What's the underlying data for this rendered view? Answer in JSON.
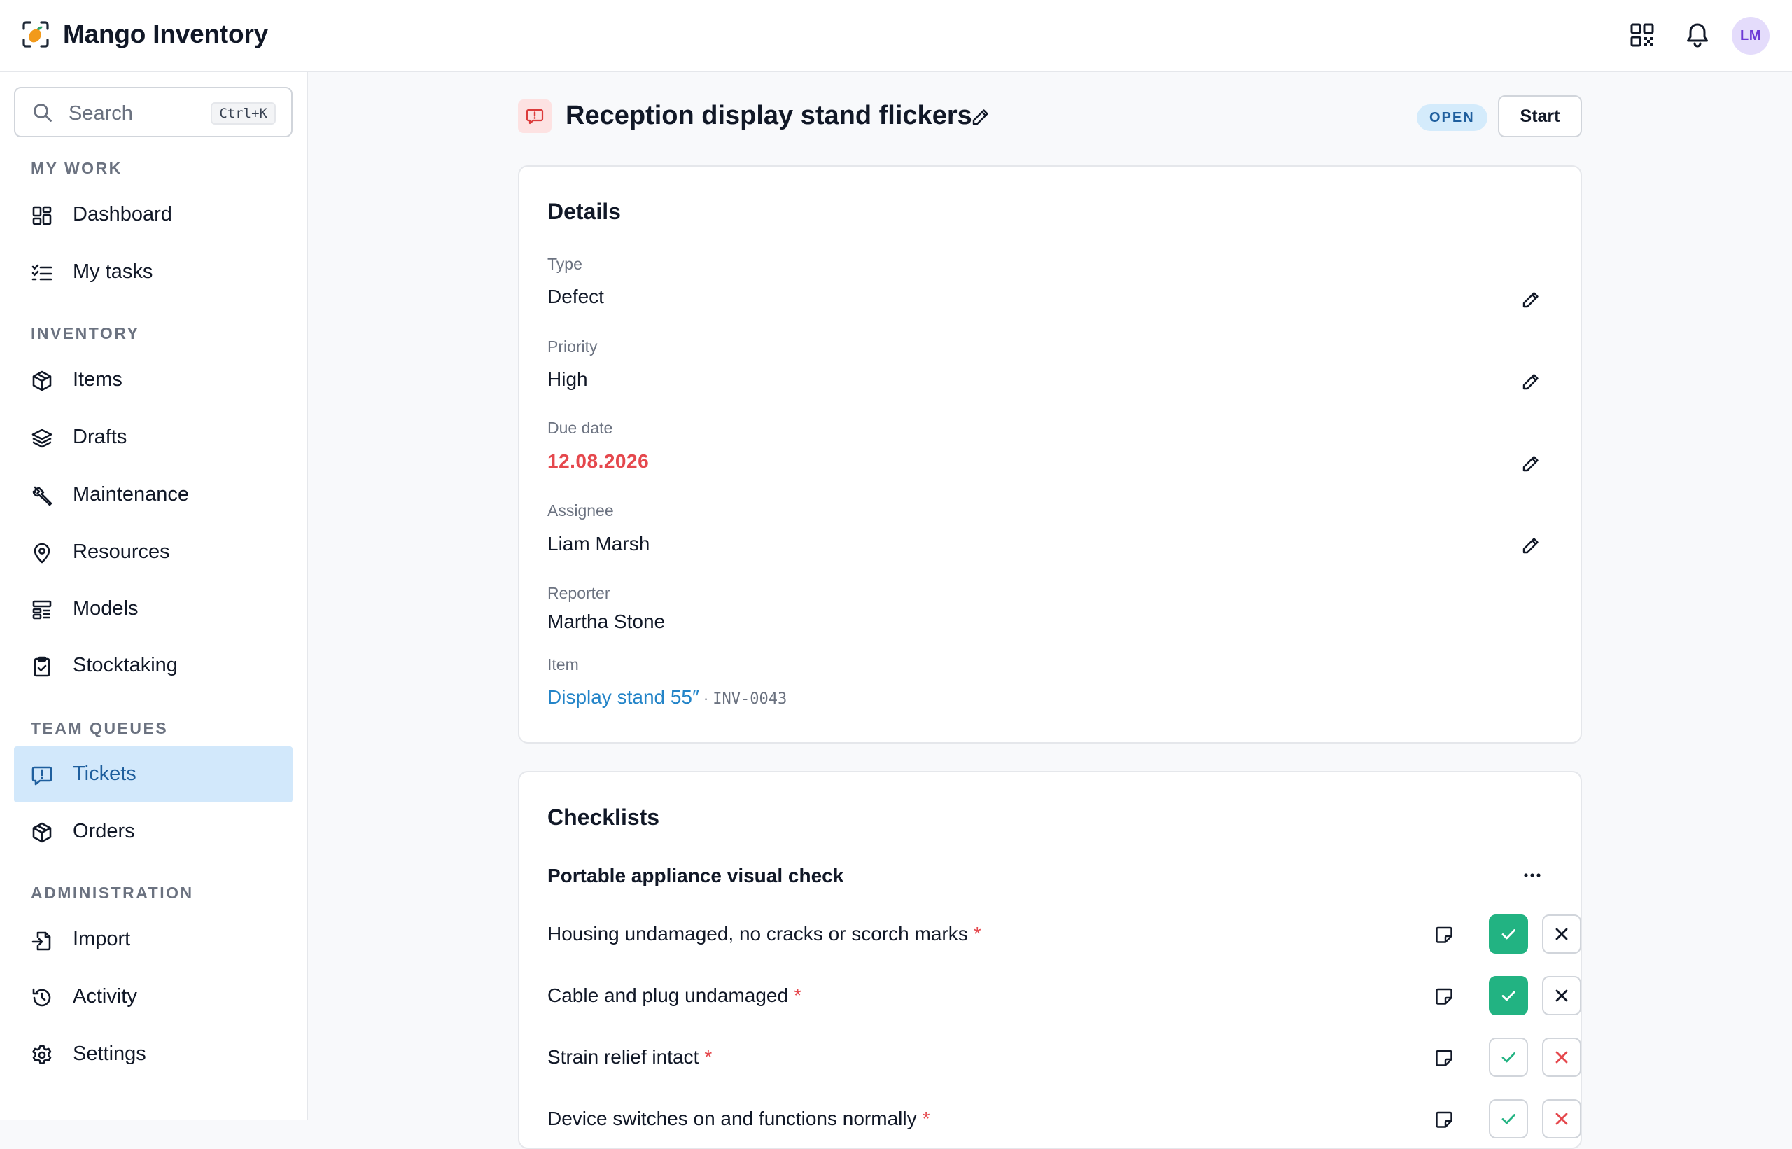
{
  "app": {
    "name": "Mango Inventory",
    "user_initials": "LM"
  },
  "header": {
    "icons": [
      "qr-code-icon",
      "bell-icon"
    ]
  },
  "sidebar": {
    "search_placeholder": "Search",
    "search_shortcut": "Ctrl+K",
    "sections": [
      {
        "label": "MY WORK",
        "items": [
          {
            "label": "Dashboard",
            "icon": "dashboard-icon"
          },
          {
            "label": "My tasks",
            "icon": "tasks-icon"
          }
        ]
      },
      {
        "label": "INVENTORY",
        "items": [
          {
            "label": "Items",
            "icon": "box-icon"
          },
          {
            "label": "Drafts",
            "icon": "layers-icon"
          },
          {
            "label": "Maintenance",
            "icon": "wrench-icon"
          },
          {
            "label": "Resources",
            "icon": "location-pin-icon"
          },
          {
            "label": "Models",
            "icon": "models-icon"
          },
          {
            "label": "Stocktaking",
            "icon": "clipboard-check-icon"
          }
        ]
      },
      {
        "label": "TEAM QUEUES",
        "items": [
          {
            "label": "Tickets",
            "icon": "ticket-alert-icon",
            "active": true
          },
          {
            "label": "Orders",
            "icon": "box-icon"
          }
        ]
      },
      {
        "label": "ADMINISTRATION",
        "items": [
          {
            "label": "Import",
            "icon": "file-import-icon"
          },
          {
            "label": "Activity",
            "icon": "history-icon"
          },
          {
            "label": "Settings",
            "icon": "gear-icon"
          }
        ]
      }
    ]
  },
  "ticket": {
    "title": "Reception display stand flickers",
    "status": "OPEN",
    "start_label": "Start"
  },
  "details": {
    "title": "Details",
    "fields": [
      {
        "label": "Type",
        "value": "Defect",
        "editable": true
      },
      {
        "label": "Priority",
        "value": "High",
        "editable": true
      },
      {
        "label": "Due date",
        "value": "12.08.2026",
        "editable": true,
        "overdue": true
      },
      {
        "label": "Assignee",
        "value": "Liam Marsh",
        "editable": true
      },
      {
        "label": "Reporter",
        "value": "Martha Stone",
        "editable": false
      }
    ],
    "item": {
      "label": "Item",
      "name": "Display stand 55″",
      "separator": "·",
      "code": "INV-0043"
    }
  },
  "checklists": {
    "title": "Checklists",
    "group_title": "Portable appliance visual check",
    "items": [
      {
        "text": "Housing undamaged, no cracks or scorch marks",
        "required": true,
        "state": "pass"
      },
      {
        "text": "Cable and plug undamaged",
        "required": true,
        "state": "pass"
      },
      {
        "text": "Strain relief intact",
        "required": true,
        "state": "none"
      },
      {
        "text": "Device switches on and functions normally",
        "required": true,
        "state": "none"
      }
    ],
    "required_mark": "*"
  },
  "colors": {
    "accent": "#2384c8",
    "active_bg": "#d2e8fb",
    "pass": "#22b382",
    "danger": "#e5484d"
  }
}
